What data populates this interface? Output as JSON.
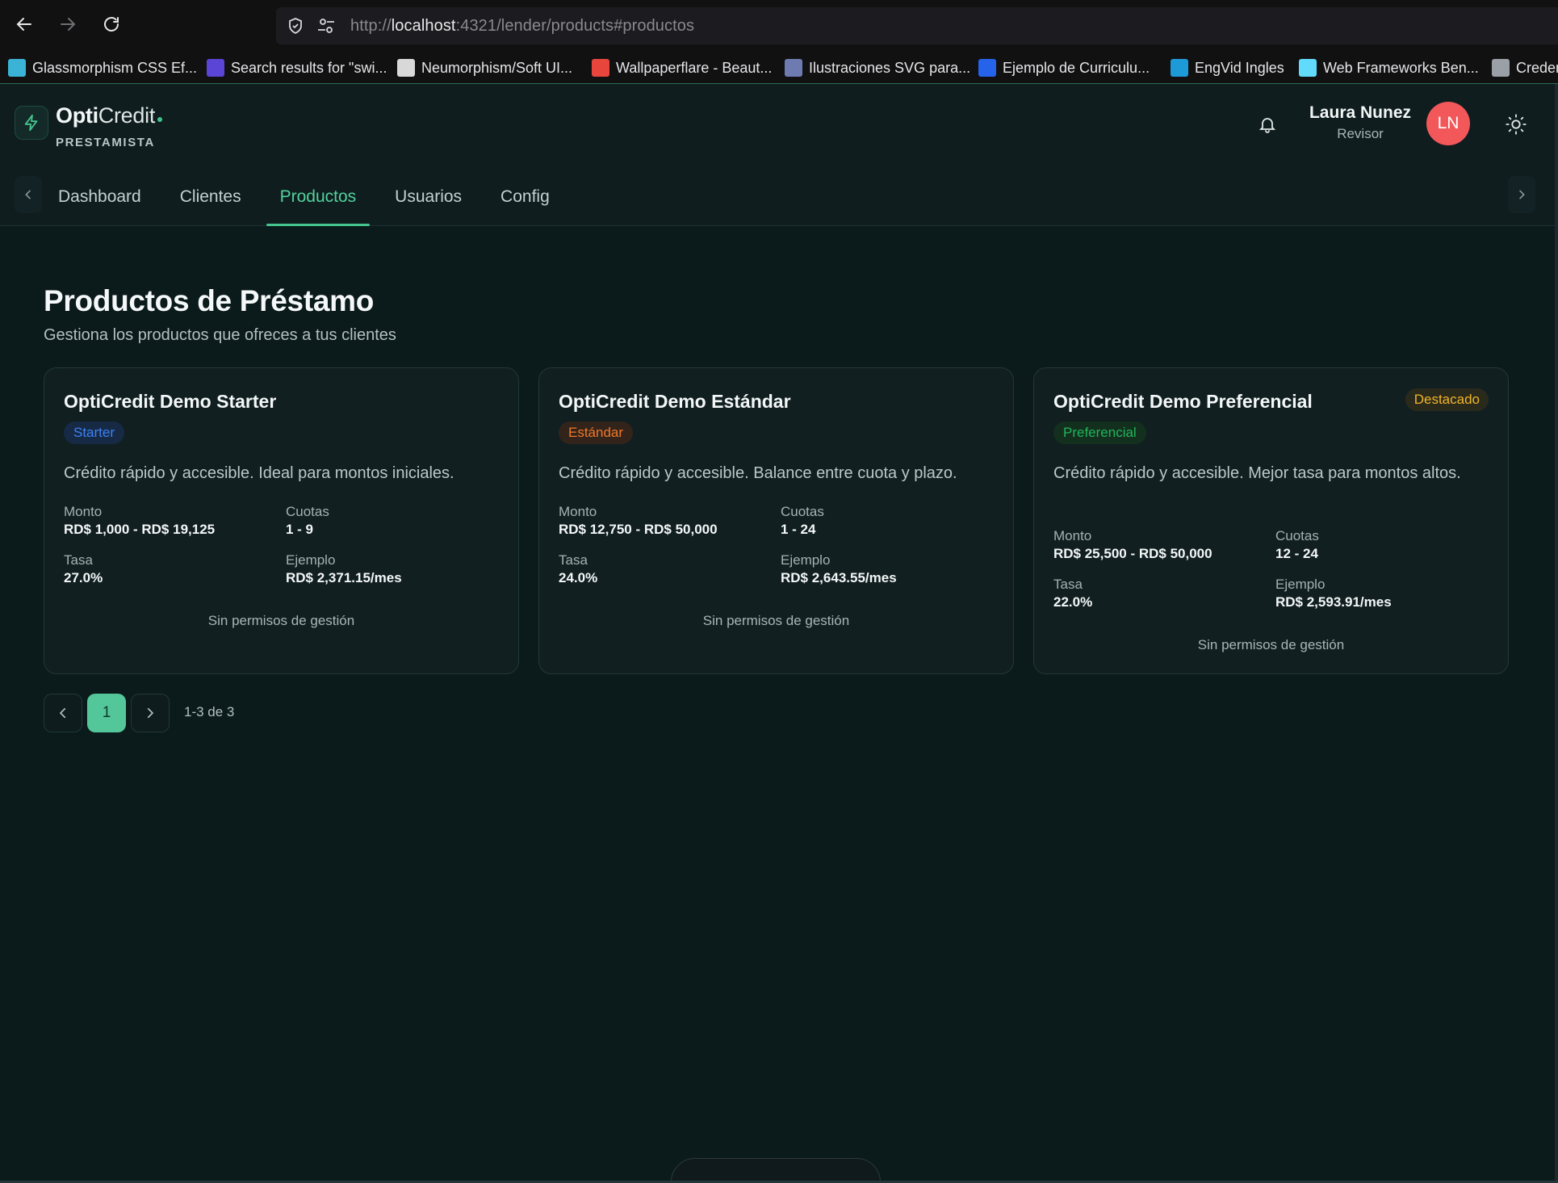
{
  "browser": {
    "url_prefix": "http://",
    "url_host": "localhost",
    "url_rest": ":4321/lender/products#productos",
    "bookmarks": [
      {
        "label": "Glassmorphism CSS Ef...",
        "icon": "glass-icon",
        "color": "#3bb3d6"
      },
      {
        "label": "Search results for \"swi...",
        "icon": "ui-icon",
        "color": "#5b45d6"
      },
      {
        "label": "Neumorphism/Soft UI...",
        "icon": "page-icon",
        "color": "#d8d8d8"
      },
      {
        "label": "Wallpaperflare - Beaut...",
        "icon": "flame-icon",
        "color": "#e8463c"
      },
      {
        "label": "Ilustraciones SVG para...",
        "icon": "cube-icon",
        "color": "#6d7bb0"
      },
      {
        "label": "Ejemplo de Curriculu...",
        "icon": "cv-icon",
        "color": "#2563eb"
      },
      {
        "label": "EngVid Ingles",
        "icon": "ev-icon",
        "color": "#1d9bd8"
      },
      {
        "label": "Web Frameworks Ben...",
        "icon": "atom-icon",
        "color": "#61dafb"
      },
      {
        "label": "Creden",
        "icon": "gear-icon",
        "color": "#9aa0a6"
      }
    ]
  },
  "header": {
    "brand_bold": "Opti",
    "brand_light": "Credit",
    "role_label": "PRESTAMISTA",
    "user_name": "Laura Nunez",
    "user_role": "Revisor",
    "avatar_initials": "LN",
    "avatar_color": "#f2575a"
  },
  "tabs": [
    {
      "label": "Dashboard",
      "active": false
    },
    {
      "label": "Clientes",
      "active": false
    },
    {
      "label": "Productos",
      "active": true
    },
    {
      "label": "Usuarios",
      "active": false
    },
    {
      "label": "Config",
      "active": false
    }
  ],
  "page": {
    "title": "Productos de Préstamo",
    "subtitle": "Gestiona los productos que ofreces a tus clientes"
  },
  "labels": {
    "monto": "Monto",
    "cuotas": "Cuotas",
    "tasa": "Tasa",
    "ejemplo": "Ejemplo",
    "no_perm": "Sin permisos de gestión"
  },
  "products": [
    {
      "name": "OptiCredit Demo Starter",
      "tier": "Starter",
      "tier_bg": "#172a45",
      "tier_color": "#3b82f6",
      "featured": "",
      "description": "Crédito rápido y accesible. Ideal para montos iniciales.",
      "monto": "RD$ 1,000 - RD$ 19,125",
      "cuotas": "1 - 9",
      "tasa": "27.0%",
      "ejemplo": "RD$ 2,371.15/mes"
    },
    {
      "name": "OptiCredit Demo Estándar",
      "tier": "Estándar",
      "tier_bg": "#33241b",
      "tier_color": "#f07828",
      "featured": "",
      "description": "Crédito rápido y accesible. Balance entre cuota y plazo.",
      "monto": "RD$ 12,750 - RD$ 50,000",
      "cuotas": "1 - 24",
      "tasa": "24.0%",
      "ejemplo": "RD$ 2,643.55/mes"
    },
    {
      "name": "OptiCredit Demo Preferencial",
      "tier": "Preferencial",
      "tier_bg": "#13301f",
      "tier_color": "#22b45a",
      "featured": "Destacado",
      "description": "Crédito rápido y accesible. Mejor tasa para montos altos.",
      "monto": "RD$ 25,500 - RD$ 50,000",
      "cuotas": "12 - 24",
      "tasa": "22.0%",
      "ejemplo": "RD$ 2,593.91/mes"
    }
  ],
  "pagination": {
    "current": "1",
    "info": "1-3 de 3"
  }
}
